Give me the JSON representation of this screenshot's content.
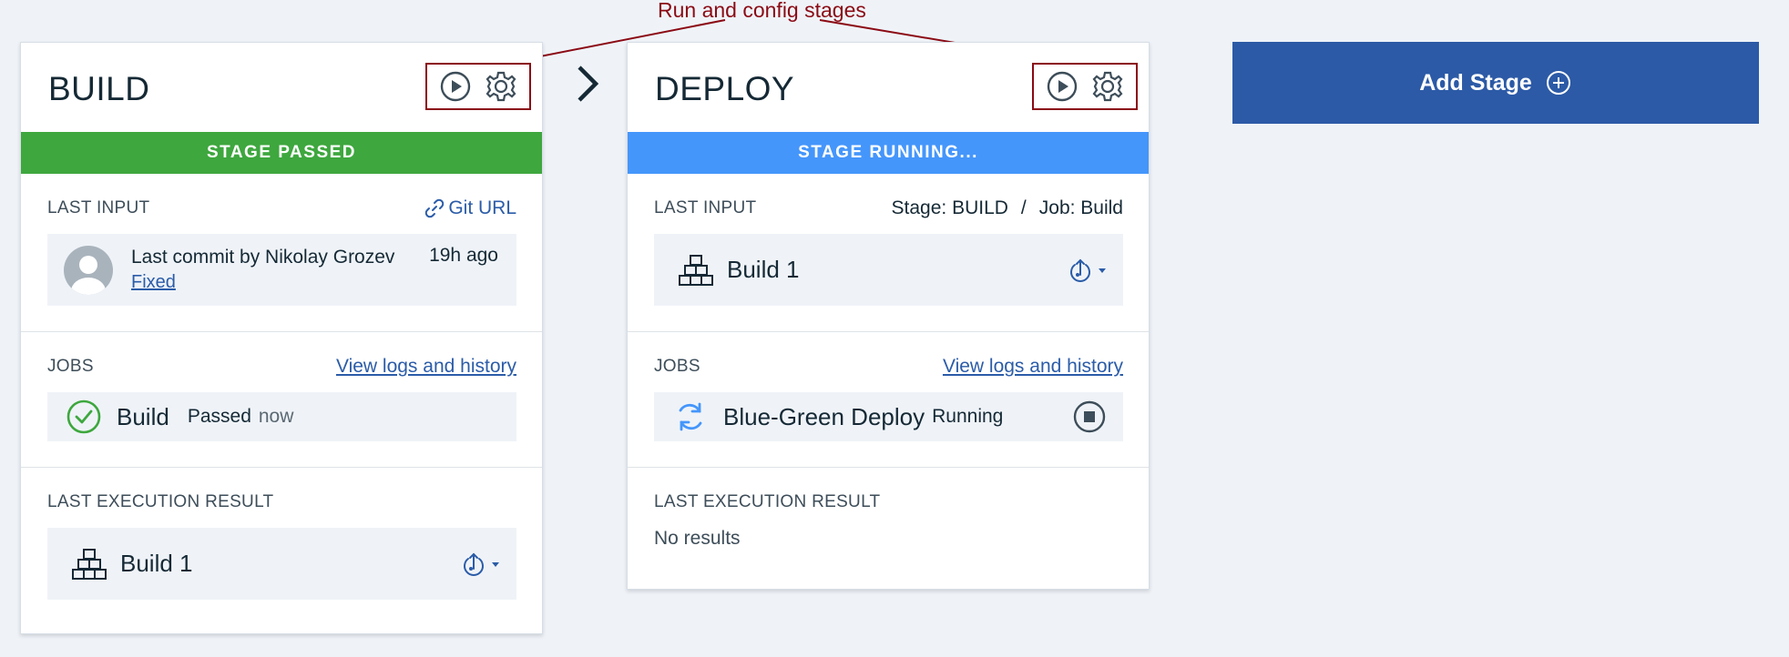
{
  "annotation": {
    "text": "Run and config stages",
    "color": "#8b0a14"
  },
  "colors": {
    "passed": "#3ea73e",
    "running": "#4596fb",
    "primary": "#2c5aa6",
    "link": "#2b5ca8",
    "background": "#eff3f8"
  },
  "build_stage": {
    "title": "BUILD",
    "status": "STAGE PASSED",
    "last_input": {
      "label": "LAST INPUT",
      "link_label": "Git URL",
      "commit_text": "Last commit by Nikolay Grozev",
      "commit_message": "Fixed",
      "time": "19h ago"
    },
    "jobs": {
      "label": "JOBS",
      "link_label": "View logs and history",
      "job_name": "Build",
      "job_status": "Passed",
      "job_time": "now"
    },
    "last_result": {
      "label": "LAST EXECUTION RESULT",
      "build_name": "Build 1"
    }
  },
  "deploy_stage": {
    "title": "DEPLOY",
    "status": "STAGE RUNNING...",
    "last_input": {
      "label": "LAST INPUT",
      "stage_text": "Stage: BUILD",
      "separator": "/",
      "job_text": "Job: Build",
      "build_name": "Build 1"
    },
    "jobs": {
      "label": "JOBS",
      "link_label": "View logs and history",
      "job_name": "Blue-Green Deploy",
      "job_status": "Running"
    },
    "last_result": {
      "label": "LAST EXECUTION RESULT",
      "text": "No results"
    }
  },
  "add_stage": {
    "label": "Add Stage"
  }
}
